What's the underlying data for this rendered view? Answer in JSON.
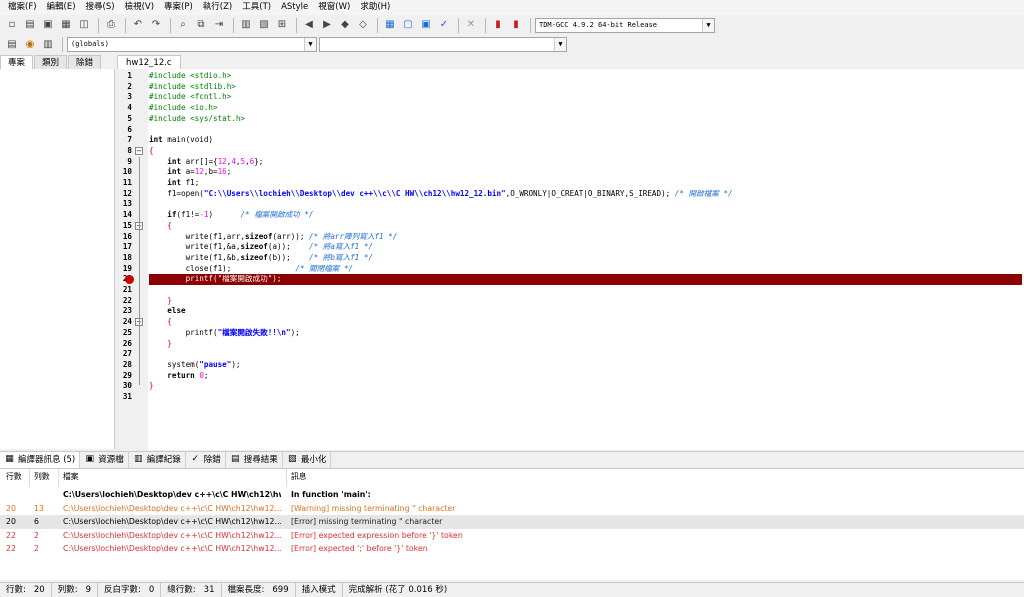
{
  "menu": [
    "檔案(F)",
    "編輯(E)",
    "搜尋(S)",
    "檢視(V)",
    "專案(P)",
    "執行(Z)",
    "工具(T)",
    "AStyle",
    "視窗(W)",
    "求助(H)"
  ],
  "toolbar": {
    "compiler_select": "TDM-GCC 4.9.2 64-bit Release",
    "scope_select": "(globals)",
    "symbol_select": ""
  },
  "left_tabs": [
    "專案",
    "類別",
    "除錯"
  ],
  "editor": {
    "file_tab": "hw12_12.c",
    "line_numbers": [
      "1",
      "2",
      "3",
      "4",
      "5",
      "6",
      "7",
      "8",
      "9",
      "10",
      "11",
      "12",
      "13",
      "14",
      "15",
      "16",
      "17",
      "18",
      "19",
      "20",
      "21",
      "22",
      "23",
      "24",
      "25",
      "26",
      "27",
      "28",
      "29",
      "30",
      "31"
    ],
    "lines": [
      [
        {
          "t": "#include <stdio.h>",
          "c": "pp"
        }
      ],
      [
        {
          "t": "#include <stdlib.h>",
          "c": "pp"
        }
      ],
      [
        {
          "t": "#include <fcntl.h>",
          "c": "pp"
        }
      ],
      [
        {
          "t": "#include <io.h>",
          "c": "pp"
        }
      ],
      [
        {
          "t": "#include <sys/stat.h>",
          "c": "pp"
        }
      ],
      [],
      [
        {
          "t": "int",
          "c": "kw"
        },
        {
          "t": " main(void)",
          "c": ""
        }
      ],
      [
        {
          "t": "{",
          "c": "op"
        }
      ],
      [
        {
          "t": "    ",
          "c": ""
        },
        {
          "t": "int",
          "c": "kw"
        },
        {
          "t": " arr[]={",
          "c": ""
        },
        {
          "t": "12",
          "c": "num"
        },
        {
          "t": ",",
          "c": ""
        },
        {
          "t": "4",
          "c": "num"
        },
        {
          "t": ",",
          "c": ""
        },
        {
          "t": "5",
          "c": "num"
        },
        {
          "t": ",",
          "c": ""
        },
        {
          "t": "6",
          "c": "num"
        },
        {
          "t": "};",
          "c": ""
        }
      ],
      [
        {
          "t": "    ",
          "c": ""
        },
        {
          "t": "int",
          "c": "kw"
        },
        {
          "t": " a=",
          "c": ""
        },
        {
          "t": "12",
          "c": "num"
        },
        {
          "t": ",b=",
          "c": ""
        },
        {
          "t": "16",
          "c": "num"
        },
        {
          "t": ";",
          "c": ""
        }
      ],
      [
        {
          "t": "    ",
          "c": ""
        },
        {
          "t": "int",
          "c": "kw"
        },
        {
          "t": " f1;",
          "c": ""
        }
      ],
      [
        {
          "t": "    f1=open(",
          "c": ""
        },
        {
          "t": "\"C:\\\\Users\\\\lochieh\\\\Desktop\\\\dev c++\\\\c\\\\C HW\\\\ch12\\\\hw12_12.bin\"",
          "c": "str"
        },
        {
          "t": ",O_WRONLY|O_CREAT|O_BINARY,S_IREAD); ",
          "c": ""
        },
        {
          "t": "/* 開啟檔案 */",
          "c": "cm"
        }
      ],
      [],
      [
        {
          "t": "    ",
          "c": ""
        },
        {
          "t": "if",
          "c": "kw"
        },
        {
          "t": "(f1!=",
          "c": ""
        },
        {
          "t": "-1",
          "c": "num"
        },
        {
          "t": ")      ",
          "c": ""
        },
        {
          "t": "/* 檔案開啟成功 */",
          "c": "cm"
        }
      ],
      [
        {
          "t": "    ",
          "c": ""
        },
        {
          "t": "{",
          "c": "op"
        }
      ],
      [
        {
          "t": "        write(f1,arr,",
          "c": ""
        },
        {
          "t": "sizeof",
          "c": "kw"
        },
        {
          "t": "(arr)); ",
          "c": ""
        },
        {
          "t": "/* 將arr陣列寫入f1 */",
          "c": "cm"
        }
      ],
      [
        {
          "t": "        write(f1,&a,",
          "c": ""
        },
        {
          "t": "sizeof",
          "c": "kw"
        },
        {
          "t": "(a));    ",
          "c": ""
        },
        {
          "t": "/* 將a寫入f1 */",
          "c": "cm"
        }
      ],
      [
        {
          "t": "        write(f1,&b,",
          "c": ""
        },
        {
          "t": "sizeof",
          "c": "kw"
        },
        {
          "t": "(b));    ",
          "c": ""
        },
        {
          "t": "/* 將b寫入f1 */",
          "c": "cm"
        }
      ],
      [
        {
          "t": "        close(f1);              ",
          "c": ""
        },
        {
          "t": "/* 關閉檔案 */",
          "c": "cm"
        }
      ],
      [
        {
          "t": "        printf(\"檔案開啟成功\");",
          "c": "errcode"
        }
      ],
      [],
      [
        {
          "t": "    ",
          "c": ""
        },
        {
          "t": "}",
          "c": "op"
        }
      ],
      [
        {
          "t": "    ",
          "c": ""
        },
        {
          "t": "else",
          "c": "kw"
        }
      ],
      [
        {
          "t": "    ",
          "c": ""
        },
        {
          "t": "{",
          "c": "op"
        }
      ],
      [
        {
          "t": "        printf(",
          "c": ""
        },
        {
          "t": "\"檔案開啟失敗!!\\n\"",
          "c": "str"
        },
        {
          "t": ");",
          "c": ""
        }
      ],
      [
        {
          "t": "    ",
          "c": ""
        },
        {
          "t": "}",
          "c": "op"
        }
      ],
      [],
      [
        {
          "t": "    system(",
          "c": ""
        },
        {
          "t": "\"pause\"",
          "c": "str"
        },
        {
          "t": ");",
          "c": ""
        }
      ],
      [
        {
          "t": "    ",
          "c": ""
        },
        {
          "t": "return",
          "c": "kw"
        },
        {
          "t": " ",
          "c": ""
        },
        {
          "t": "0",
          "c": "num"
        },
        {
          "t": ";",
          "c": ""
        }
      ],
      [
        {
          "t": "}",
          "c": "op"
        }
      ],
      []
    ],
    "error_line_index": 19
  },
  "bottom_tabs": [
    "編譯器訊息 (5)",
    "資源檔",
    "編譯紀錄",
    "除錯",
    "搜尋結果",
    "最小化"
  ],
  "messages": {
    "headers": [
      "行數",
      "列數",
      "檔案",
      "訊息"
    ],
    "rows": [
      {
        "line": "",
        "col": "",
        "file": "C:\\Users\\lochieh\\Desktop\\dev c++\\c\\C HW\\ch12\\hw...",
        "msg": "In function 'main':",
        "kind": "hdr"
      },
      {
        "line": "20",
        "col": "13",
        "file": "C:\\Users\\lochieh\\Desktop\\dev c++\\c\\C HW\\ch12\\hw12...",
        "msg": "[Warning] missing terminating \" character",
        "kind": "warn"
      },
      {
        "line": "20",
        "col": "6",
        "file": "C:\\Users\\lochieh\\Desktop\\dev c++\\c\\C HW\\ch12\\hw12...",
        "msg": "[Error] missing terminating \" character",
        "kind": "sel"
      },
      {
        "line": "22",
        "col": "2",
        "file": "C:\\Users\\lochieh\\Desktop\\dev c++\\c\\C HW\\ch12\\hw12...",
        "msg": "[Error] expected expression before '}' token",
        "kind": "err"
      },
      {
        "line": "22",
        "col": "2",
        "file": "C:\\Users\\lochieh\\Desktop\\dev c++\\c\\C HW\\ch12\\hw12...",
        "msg": "[Error] expected ';' before '}' token",
        "kind": "err"
      }
    ]
  },
  "status": {
    "line_label": "行數:",
    "line": "20",
    "col_label": "列數:",
    "col": "9",
    "sel_label": "反白字數:",
    "sel": "0",
    "total_label": "總行數:",
    "total": "31",
    "len_label": "檔案長度:",
    "len": "699",
    "mode": "插入模式",
    "parse": "完成解析 (花了 0.016 秒)"
  }
}
